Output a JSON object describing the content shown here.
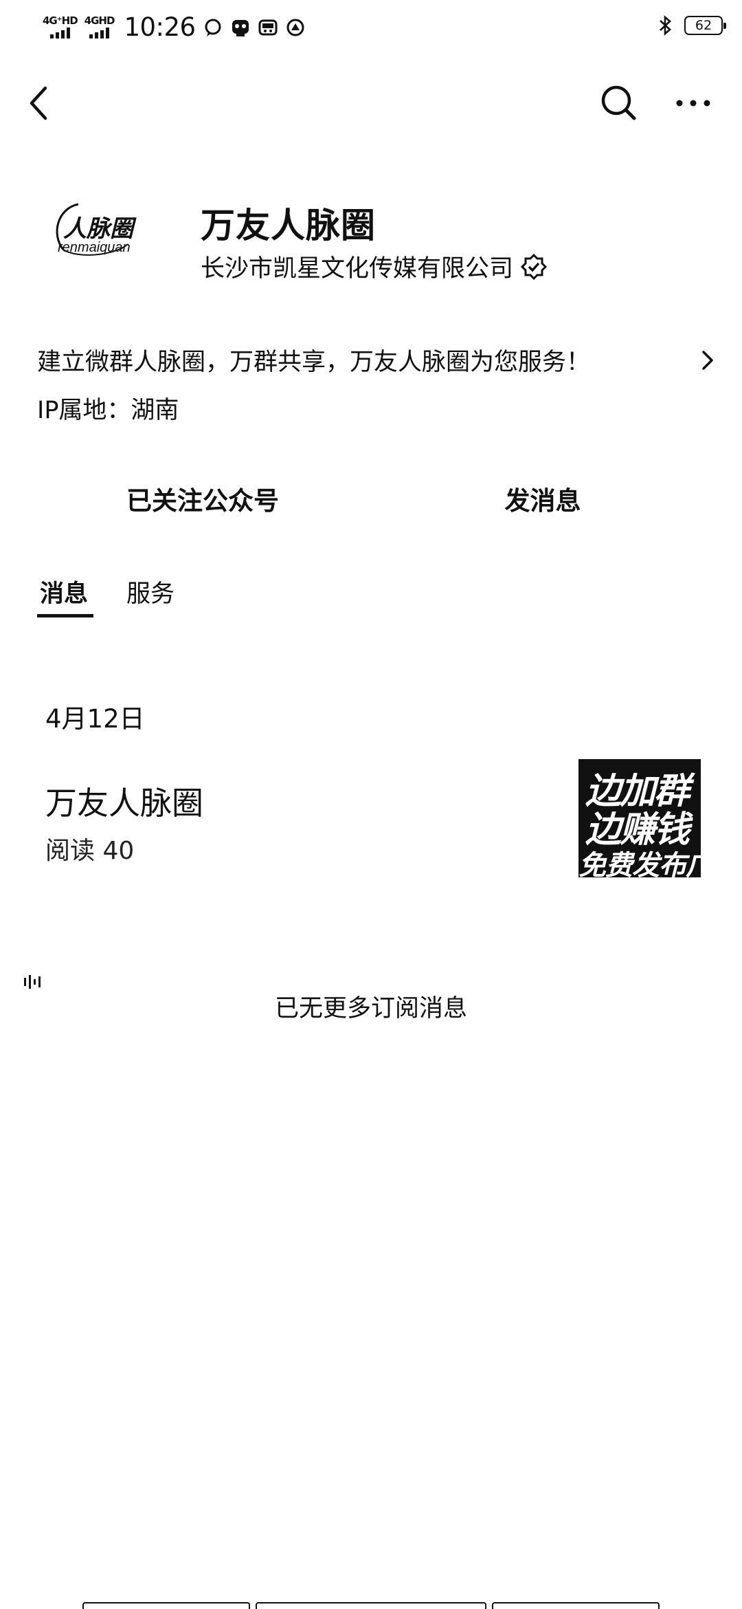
{
  "status_bar": {
    "net1": "4G⁺HD",
    "net2": "4GHD",
    "time": "10:26",
    "battery": "62",
    "icons": [
      "chat-bubble-icon",
      "app-icon",
      "cat-face-icon",
      "alert-badge-icon",
      "bluetooth-icon"
    ]
  },
  "nav": {
    "back_icon": "chevron-left-icon",
    "search_icon": "search-icon",
    "more_icon": "more-dots-icon"
  },
  "profile": {
    "logo_line1": "人脉圈",
    "logo_line2": "renmaiquan",
    "name": "万友人脉圈",
    "company": "长沙市凯星文化传媒有限公司",
    "verified_icon": "verified-badge-icon",
    "description": "建立微群人脉圈，万群共享，万友人脉圈为您服务！",
    "ip_location": "IP属地：湖南"
  },
  "actions": {
    "follow_label": "已关注公众号",
    "message_label": "发消息"
  },
  "tabs": [
    {
      "label": "消息",
      "active": true
    },
    {
      "label": "服务",
      "active": false
    }
  ],
  "feed": {
    "date": "4月12日",
    "article": {
      "title": "万友人脉圈",
      "reads": "阅读 40",
      "thumb_line1": "边加群",
      "thumb_line2": "边赚钱",
      "thumb_line3": "免费发布广告"
    },
    "end_text": "已无更多订阅消息"
  }
}
